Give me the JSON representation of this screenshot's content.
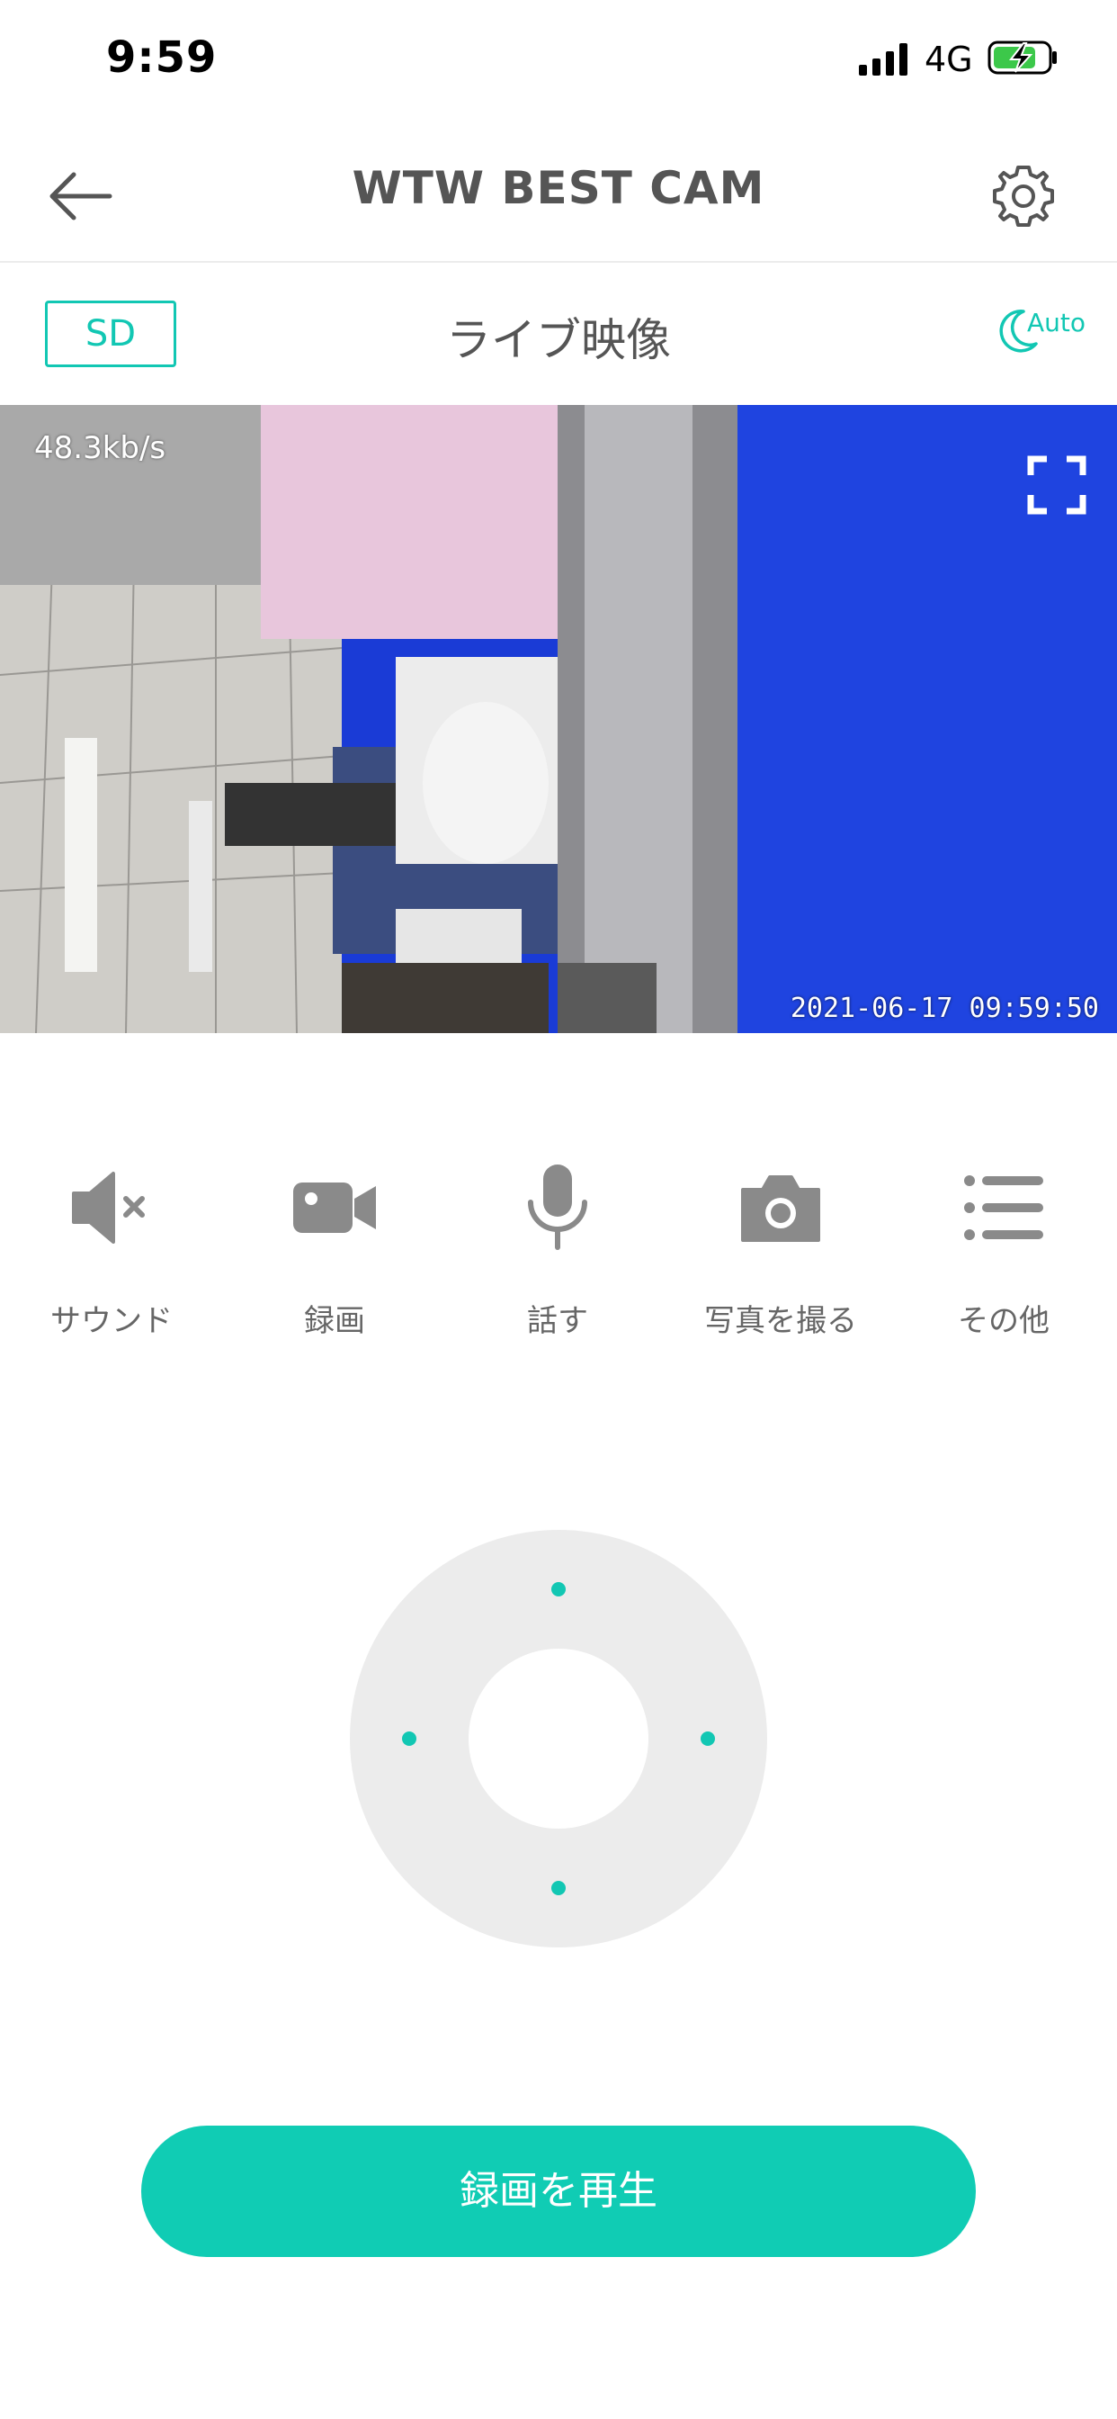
{
  "status_bar": {
    "time": "9:59",
    "network": "4G"
  },
  "header": {
    "title": "WTW BEST CAM"
  },
  "subbar": {
    "quality_label": "SD",
    "live_label": "ライブ映像",
    "night_mode_label": "Auto"
  },
  "video": {
    "bitrate": "48.3kb/s",
    "timestamp": "2021-06-17  09:59:50"
  },
  "controls": [
    {
      "label": "サウンド",
      "icon": "speaker-muted-icon"
    },
    {
      "label": "録画",
      "icon": "video-camera-icon"
    },
    {
      "label": "話す",
      "icon": "microphone-icon"
    },
    {
      "label": "写真を撮る",
      "icon": "camera-icon"
    },
    {
      "label": "その他",
      "icon": "list-icon"
    }
  ],
  "playback_button": {
    "label": "録画を再生"
  },
  "colors": {
    "accent": "#12c7b3",
    "button": "#10ccb4",
    "icon_gray": "#8a8a8a",
    "dpad_bg": "#ececec"
  }
}
